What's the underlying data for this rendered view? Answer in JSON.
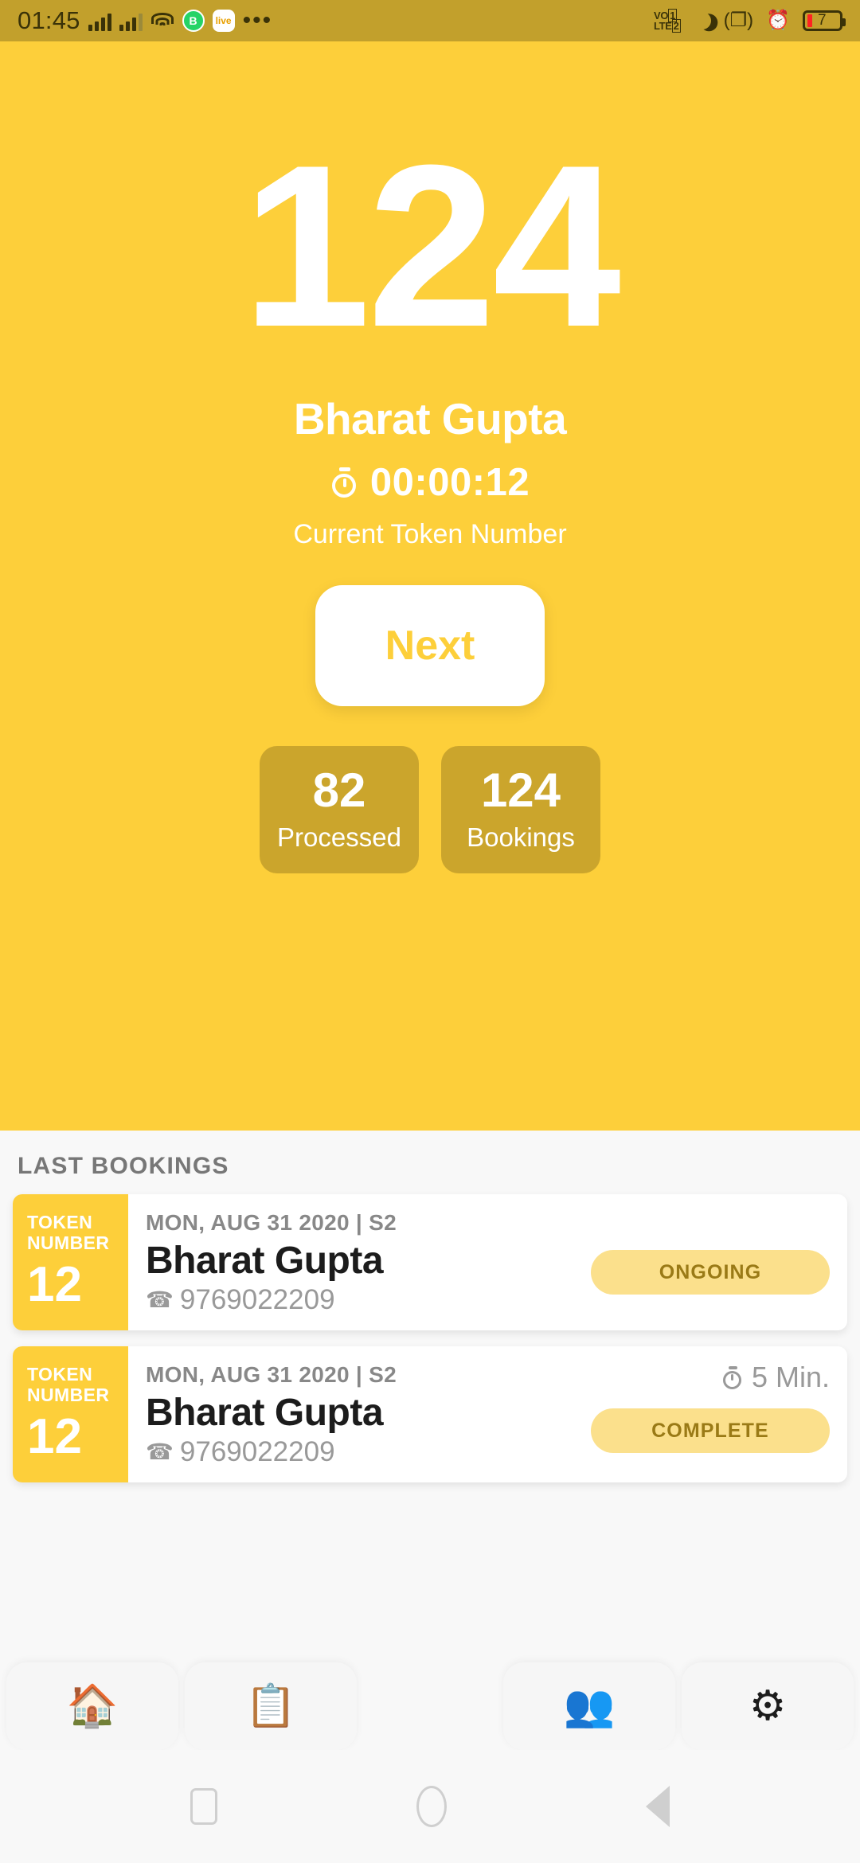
{
  "status_bar": {
    "time": "01:45",
    "volte_label": "VO1\nLTE2",
    "battery_level": "7",
    "icons": [
      "signal-bars",
      "signal-bars-2",
      "wifi-icon",
      "whatsapp-icon",
      "live-app-icon",
      "more-dots-icon",
      "volte-icon",
      "dnd-moon-icon",
      "vibrate-icon",
      "alarm-icon",
      "battery-icon"
    ],
    "whatsapp_glyph": "B",
    "live_glyph": "live",
    "more_glyph": "•••",
    "vibrate_glyph": "❲❳",
    "alarm_glyph": "⏰"
  },
  "hero": {
    "token_number": "124",
    "customer_name": "Bharat Gupta",
    "elapsed_time": "00:00:12",
    "caption": "Current Token Number",
    "next_button": "Next",
    "stats": [
      {
        "value": "82",
        "label": "Processed"
      },
      {
        "value": "124",
        "label": "Bookings"
      }
    ]
  },
  "last_bookings": {
    "section_title": "LAST BOOKINGS",
    "token_label": "TOKEN\nNUMBER",
    "token_label_line1": "TOKEN",
    "token_label_line2": "NUMBER",
    "phone_icon_glyph": "📞",
    "items": [
      {
        "token": "12",
        "date": "MON, AUG 31 2020 | S2",
        "name": "Bharat Gupta",
        "phone": "9769022209",
        "duration": "",
        "status": "ONGOING"
      },
      {
        "token": "12",
        "date": "MON, AUG 31 2020 | S2",
        "name": "Bharat Gupta",
        "phone": "9769022209",
        "duration": "5 Min.",
        "status": "COMPLETE"
      }
    ]
  },
  "bottom_nav": {
    "items": [
      {
        "icon": "home-icon",
        "glyph": "🏠",
        "active": true
      },
      {
        "icon": "clipboard-icon",
        "glyph": "📋",
        "active": false
      },
      {
        "icon": "people-icon",
        "glyph": "👥",
        "active": false
      },
      {
        "icon": "gear-icon",
        "glyph": "⚙",
        "active": false
      }
    ],
    "fab_label": "+"
  },
  "android_nav": {
    "recents": "recents-square-icon",
    "home": "home-circle-icon",
    "back": "back-triangle-icon"
  },
  "colors": {
    "brand_yellow": "#FDCF3A",
    "status_bar": "#C2A02C",
    "stat_card": "#CBA52C",
    "badge_bg": "#FBE08C",
    "badge_text": "#9A7A16",
    "page_bg": "#F8F8F8"
  }
}
